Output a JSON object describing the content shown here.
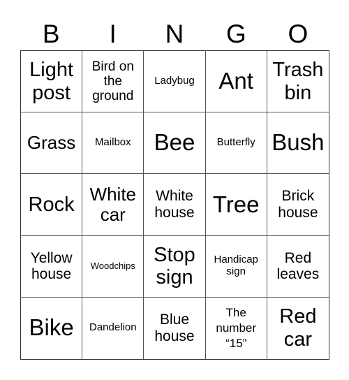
{
  "header": {
    "letters": [
      "B",
      "I",
      "N",
      "G",
      "O"
    ]
  },
  "squares": [
    "Light post",
    "Bird on the ground",
    "Ladybug",
    "Ant",
    "Trash bin",
    "Grass",
    "Mailbox",
    "Bee",
    "Butterfly",
    "Bush",
    "Rock",
    "White car",
    "White house",
    "Tree",
    "Brick house",
    "Yellow house",
    "Woodchips",
    "Stop sign",
    "Handicap sign",
    "Red leaves",
    "Bike",
    "Dandelion",
    "Blue house",
    "The number “15”",
    "Red car"
  ],
  "colors": {
    "grid_line": "#555555",
    "text": "#000000",
    "background": "#ffffff"
  }
}
